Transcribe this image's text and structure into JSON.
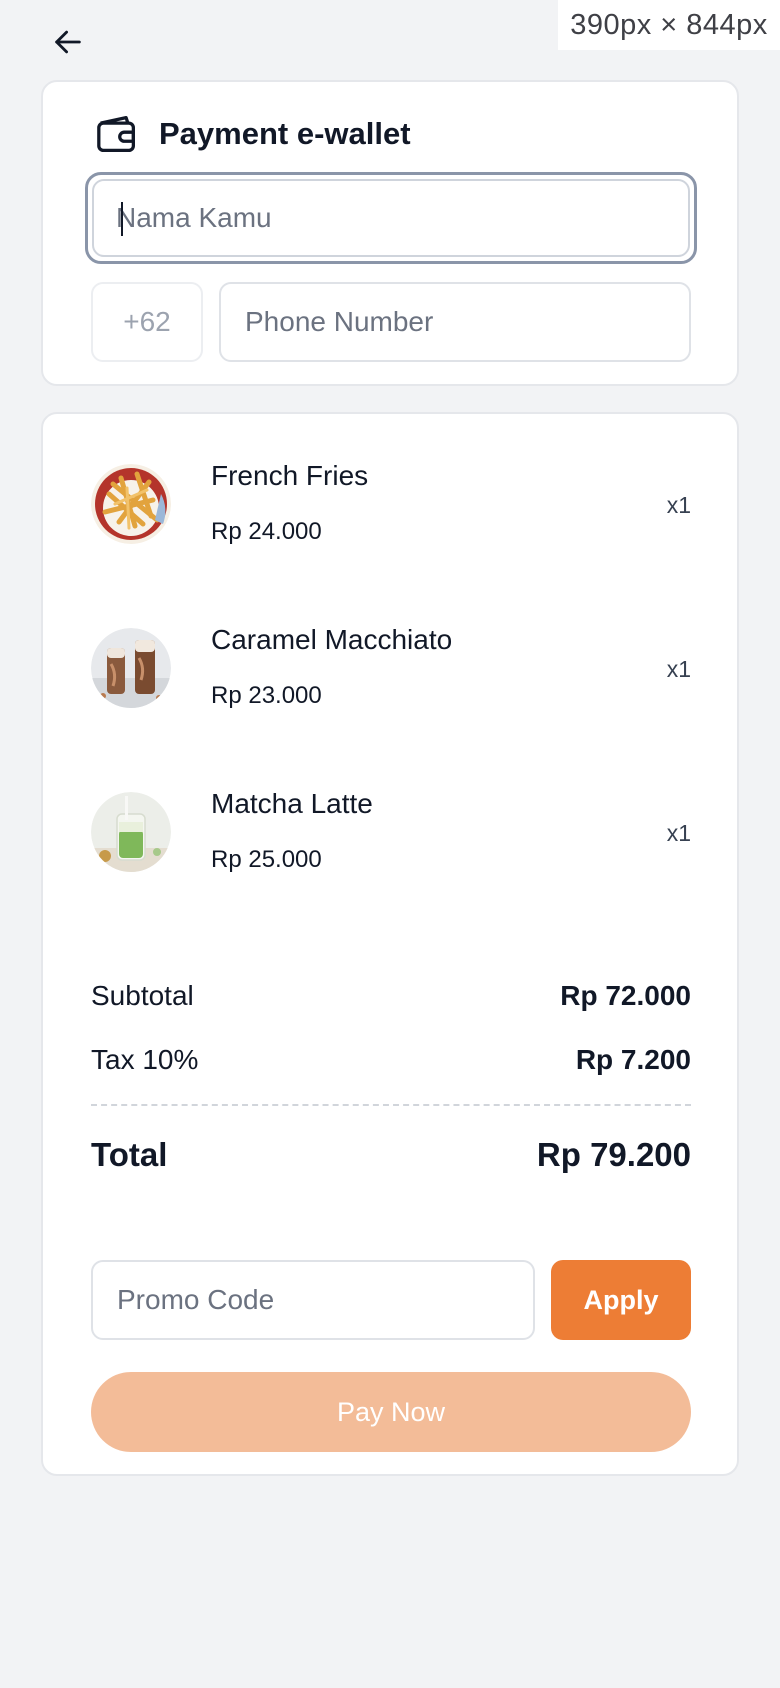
{
  "viewport_label": "390px × 844px",
  "wallet": {
    "title": "Payment e-wallet",
    "name_placeholder": "Nama Kamu",
    "name_value": "",
    "phone_prefix": "+62",
    "phone_placeholder": "Phone Number",
    "phone_value": ""
  },
  "items": [
    {
      "name": "French Fries",
      "price": "Rp 24.000",
      "qty": "x1",
      "image": "french-fries"
    },
    {
      "name": "Caramel Macchiato",
      "price": "Rp 23.000",
      "qty": "x1",
      "image": "caramel-macchiato"
    },
    {
      "name": "Matcha Latte",
      "price": "Rp 25.000",
      "qty": "x1",
      "image": "matcha-latte"
    }
  ],
  "summary": {
    "subtotal_label": "Subtotal",
    "subtotal_value": "Rp 72.000",
    "tax_label": "Tax 10%",
    "tax_value": "Rp 7.200",
    "total_label": "Total",
    "total_value": "Rp 79.200"
  },
  "promo": {
    "placeholder": "Promo Code",
    "value": "",
    "apply_label": "Apply"
  },
  "pay_label": "Pay Now",
  "colors": {
    "accent": "#ed7d35",
    "pay_disabled": "#f3bc98",
    "background": "#f2f3f5"
  },
  "icons": {
    "back": "arrow-left-icon",
    "wallet": "wallet-icon"
  }
}
